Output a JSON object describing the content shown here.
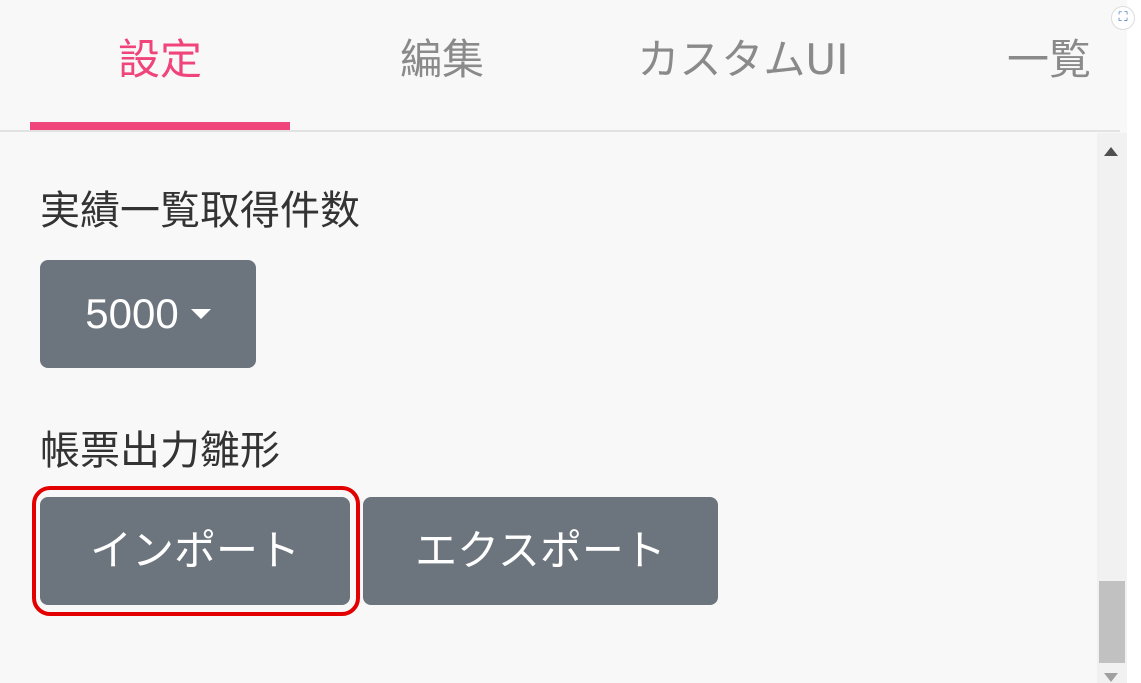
{
  "tabs": [
    {
      "label": "設定",
      "active": true
    },
    {
      "label": "編集",
      "active": false
    },
    {
      "label": "カスタムUI",
      "active": false
    },
    {
      "label": "一覧",
      "active": false
    }
  ],
  "settings": {
    "count_label": "実績一覧取得件数",
    "count_value": "5000",
    "template_label": "帳票出力雛形",
    "import_label": "インポート",
    "export_label": "エクスポート"
  },
  "colors": {
    "accent": "#f0457a",
    "button": "#6c757d",
    "highlight": "#e30000"
  },
  "icons": {
    "expand": "expand-icon",
    "dropdown": "caret-down-icon"
  }
}
